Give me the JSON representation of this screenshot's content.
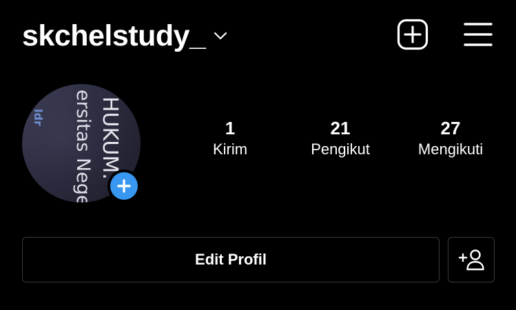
{
  "header": {
    "username": "skchelstudy_",
    "chevron_icon": "chevron-down-icon",
    "new_post_icon": "plus-square-icon",
    "menu_icon": "hamburger-menu-icon"
  },
  "profile": {
    "avatar_photo_text": {
      "line1": "HUKUM.",
      "line2": "ersitas Nege",
      "line3": "ldr"
    },
    "add_story_icon": "plus-circle-icon",
    "accent_color": "#3897f0"
  },
  "stats": {
    "posts": {
      "value": "1",
      "label": "Kirim"
    },
    "followers": {
      "value": "21",
      "label": "Pengikut"
    },
    "following": {
      "value": "27",
      "label": "Mengikuti"
    }
  },
  "actions": {
    "edit_profile_label": "Edit Profil",
    "discover_people_icon": "add-person-icon"
  }
}
